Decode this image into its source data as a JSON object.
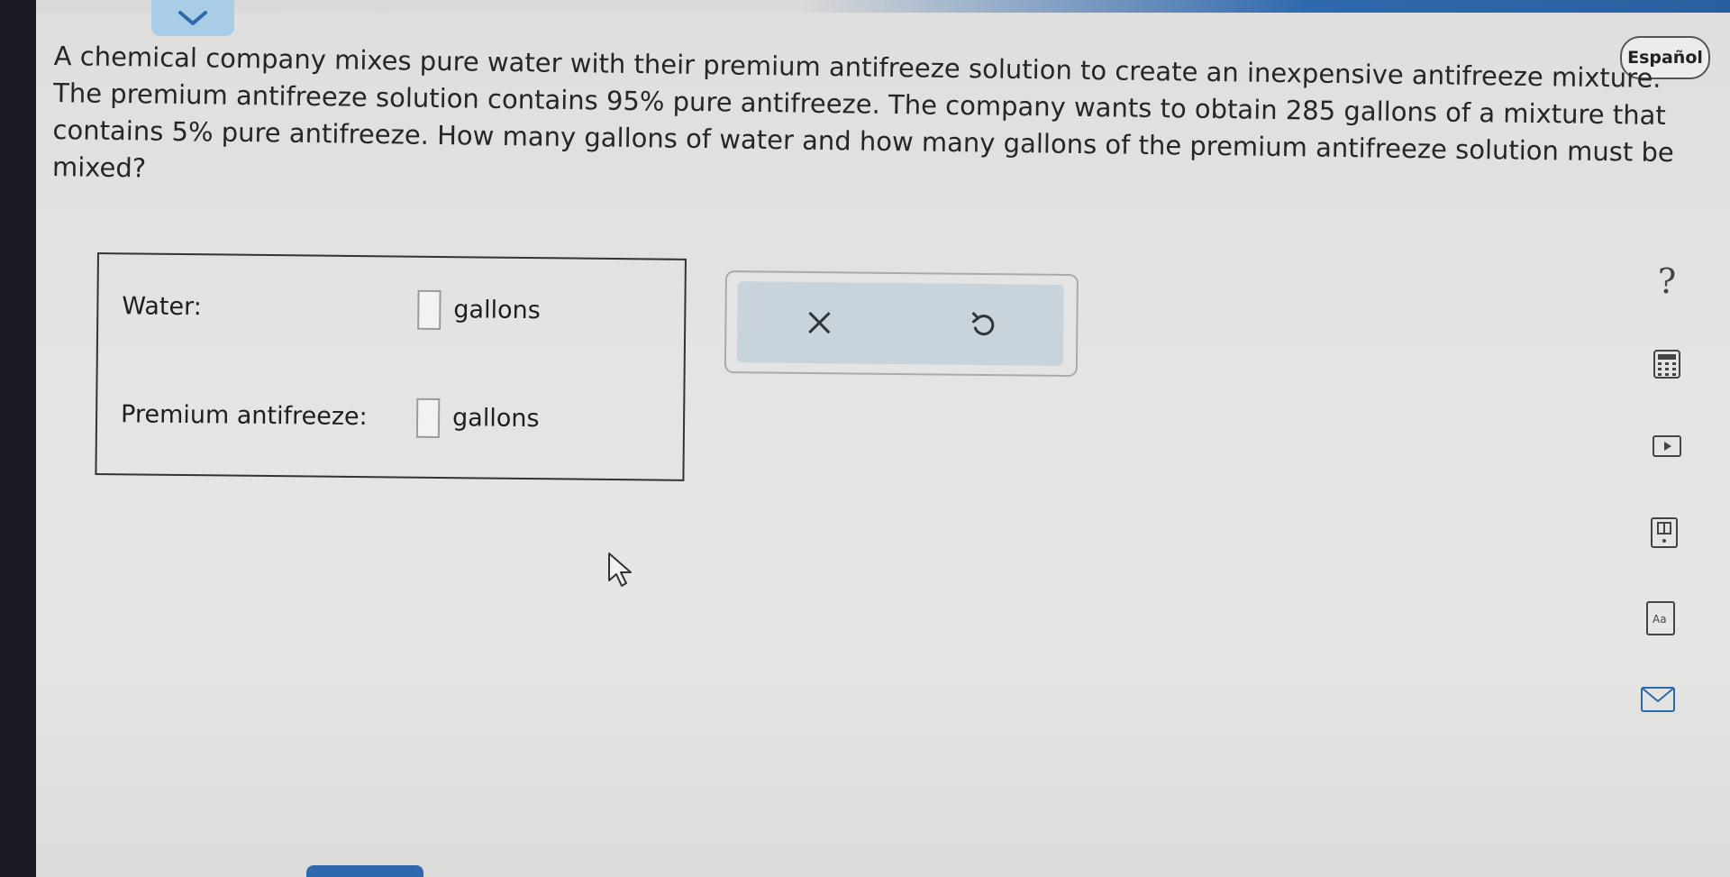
{
  "header": {
    "language_button": "Español"
  },
  "problem": {
    "line1": "A chemical company mixes pure water with their premium antifreeze solution to create an inexpensive antifreeze mixture.",
    "line2": "The premium antifreeze solution contains 95% pure antifreeze. The company wants to obtain 285 gallons of a mixture that",
    "line3": "contains 5% pure antifreeze. How many gallons of water and how many gallons of the premium antifreeze solution must be",
    "line4": "mixed?"
  },
  "answers": {
    "water": {
      "label": "Water:",
      "value": "",
      "unit": "gallons"
    },
    "premium": {
      "label": "Premium antifreeze:",
      "value": "",
      "unit": "gallons"
    }
  },
  "tools": {
    "clear_icon": "close-icon",
    "undo_icon": "undo-icon"
  },
  "sidebar": {
    "help_label": "?",
    "icons": [
      "help-icon",
      "calculator-icon",
      "play-icon",
      "textbook-icon",
      "text-size-icon",
      "mail-icon"
    ]
  },
  "colors": {
    "accent_blue": "#2f69ad",
    "collapse_tab": "#a9cde6",
    "tool_panel": "#c9d3dc"
  }
}
